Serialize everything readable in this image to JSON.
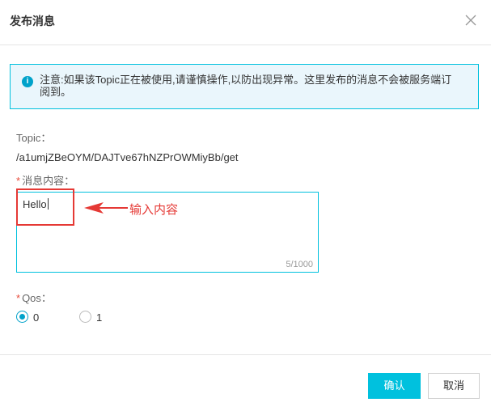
{
  "dialog": {
    "title": "发布消息",
    "close_icon": "close-icon"
  },
  "notice": {
    "icon": "info-icon",
    "icon_glyph": "i",
    "text": "注意:如果该Topic正在被使用,请谨慎操作,以防出现异常。这里发布的消息不会被服务端订阅到。"
  },
  "form": {
    "topic_label": "Topic：",
    "topic_value": "/a1umjZBeOYM/DAJTve67hNZPrOWMiyBb/get",
    "content_label": "消息内容：",
    "content_value": "Hello",
    "content_counter": "5/1000",
    "qos_label": "Qos：",
    "required_mark": "*",
    "qos_options": [
      "0",
      "1"
    ],
    "qos_selected": "0"
  },
  "annotation": {
    "text": "输入内容",
    "color": "#e53935"
  },
  "footer": {
    "confirm_label": "确认",
    "cancel_label": "取消"
  },
  "colors": {
    "accent": "#00c1de",
    "notice_bg": "#eaf6fc",
    "info_icon": "#00a2ca",
    "required": "#e74c3c"
  }
}
